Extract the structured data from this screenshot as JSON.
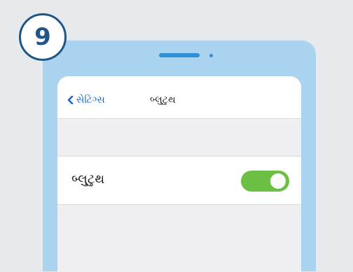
{
  "step": {
    "number": "9"
  },
  "navbar": {
    "back_label": "સેટિંગ્સ",
    "title": "બ્લુટુથ"
  },
  "bluetooth_row": {
    "label": "બ્લુટુથ",
    "toggle_on": true
  },
  "colors": {
    "accent": "#1565d0",
    "toggle_on": "#6cbe45",
    "phone_frame": "#a9d3ef",
    "badge": "#20558a"
  }
}
